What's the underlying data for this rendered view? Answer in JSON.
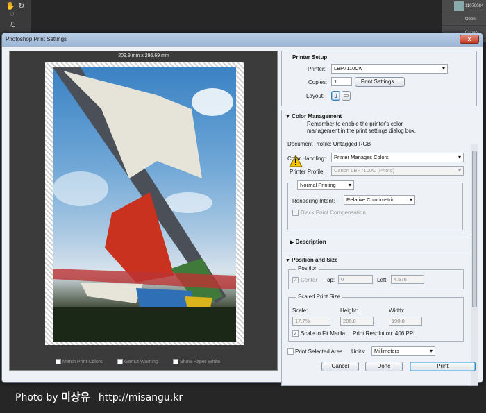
{
  "dialog": {
    "title": "Photoshop Print Settings",
    "close_label": "x"
  },
  "preview": {
    "dimensions": "209.9 mm x 296.69 mm",
    "match_print_colors": "Match Print Colors",
    "gamut_warning": "Gamut Warning",
    "show_paper_white": "Show Paper White"
  },
  "printer_setup": {
    "heading": "Printer Setup",
    "printer_label": "Printer:",
    "printer_value": "LBP7110Cw",
    "copies_label": "Copies:",
    "copies_value": "1",
    "print_settings_button": "Print Settings...",
    "layout_label": "Layout:"
  },
  "color_management": {
    "heading": "Color Management",
    "notice": "Remember to enable the printer's color management in the print settings dialog box.",
    "document_profile": "Document Profile: Untagged RGB",
    "color_handling_label": "Color Handling:",
    "color_handling_value": "Printer Manages Colors",
    "printer_profile_label": "Printer Profile:",
    "printer_profile_value": "Canon LBP7100C (Photo)",
    "print_mode_value": "Normal Printing",
    "rendering_intent_label": "Rendering Intent:",
    "rendering_intent_value": "Relative Colorimetric",
    "black_point_label": "Black Point Compensation"
  },
  "description": {
    "heading": "Description"
  },
  "position_size": {
    "heading": "Position and Size",
    "position_legend": "Position",
    "center_label": "Center",
    "top_label": "Top:",
    "top_value": "0",
    "left_label": "Left:",
    "left_value": "4.576",
    "scaled_legend": "Scaled Print Size",
    "scale_label": "Scale:",
    "scale_value": "17.7%",
    "height_label": "Height:",
    "height_value": "286.8",
    "width_label": "Width:",
    "width_value": "190.8",
    "scale_to_fit_label": "Scale to Fit Media",
    "print_resolution": "Print Resolution: 406 PPI",
    "print_selected_area_label": "Print Selected Area",
    "units_label": "Units:",
    "units_value": "Millimeters"
  },
  "buttons": {
    "cancel": "Cancel",
    "done": "Done",
    "print": "Print"
  },
  "background": {
    "layer_1": "11070084",
    "layer_2": "Open",
    "layer_3": "Curves"
  },
  "watermark": {
    "prefix": "Photo by",
    "name": "미상유",
    "url": "http://misangu.kr"
  },
  "colors": {
    "accent": "#3c7fb1",
    "titlebar": "#b9cde5",
    "close": "#c43b22",
    "warning": "#f2c200"
  }
}
